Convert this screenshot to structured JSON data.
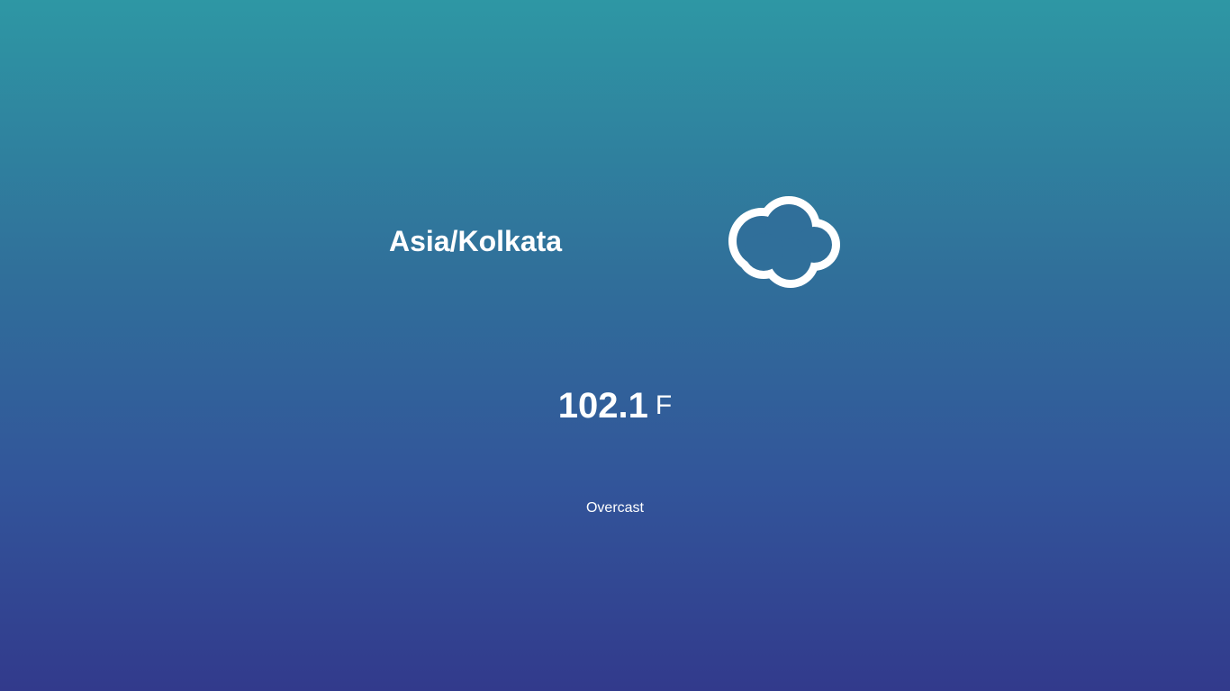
{
  "location": {
    "timezone": "Asia/Kolkata"
  },
  "weather": {
    "icon": "cloud-icon",
    "temperature_value": "102.1",
    "temperature_unit": "F",
    "summary": "Overcast"
  }
}
